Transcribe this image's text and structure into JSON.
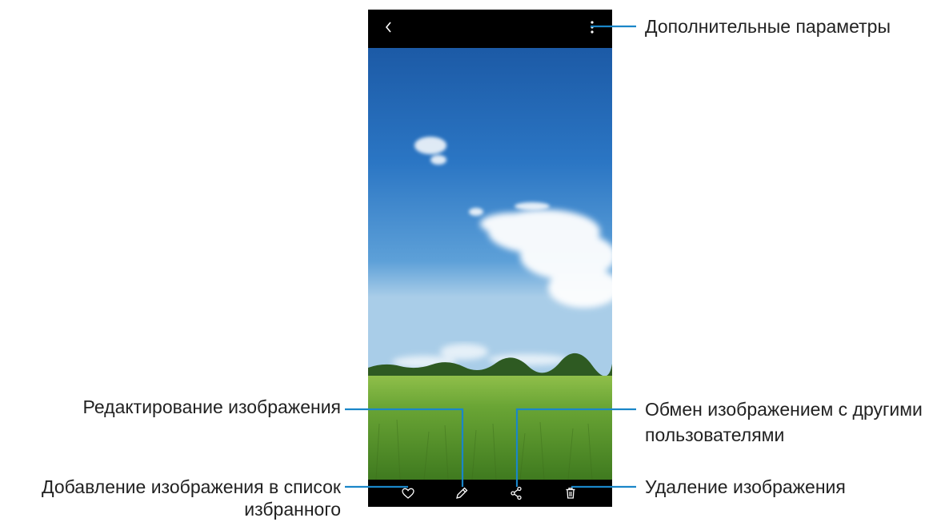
{
  "labels": {
    "more_options": "Дополнительные параметры",
    "edit_image": "Редактирование изображения",
    "share_line1": "Обмен изображением с другими",
    "share_line2": "пользователями",
    "favorite_line1": "Добавление изображения в список",
    "favorite_line2": "избранного",
    "delete_image": "Удаление изображения"
  },
  "icons": {
    "top_left": "back-icon",
    "top_right": "more-options-icon",
    "bottom": [
      "heart-icon",
      "pencil-icon",
      "share-icon",
      "trash-icon"
    ]
  },
  "colors": {
    "callout_line": "#1a86c8",
    "bars": "#000000",
    "sky_top": "#1c5aa6",
    "grass": "#5f9a2c"
  }
}
